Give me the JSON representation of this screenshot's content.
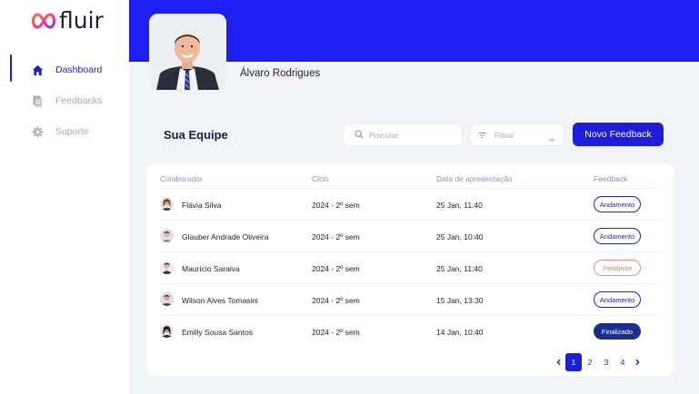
{
  "brand": {
    "name": "fluir",
    "accent": "#1E1ED8",
    "header_color": "#1E1EF0",
    "dark": "#1B2E8C",
    "pending": "#F07070"
  },
  "sidebar": {
    "items": [
      {
        "label": "Dashboard",
        "icon": "home-icon",
        "active": true
      },
      {
        "label": "Feedbacks",
        "icon": "document-icon",
        "active": false
      },
      {
        "label": "Suporte",
        "icon": "gear-icon",
        "active": false
      }
    ]
  },
  "profile": {
    "name": "Álvaro Rodrigues"
  },
  "team": {
    "title": "Sua Equipe",
    "search_placeholder": "Procurar",
    "filter_label": "Filtrar",
    "new_button": "Novo Feedback",
    "columns": [
      "Colaborador",
      "Ciclo",
      "Data de apresentação",
      "Feedback"
    ],
    "rows": [
      {
        "name": "Flávia Silva",
        "cycle": "2024 - 2º sem",
        "date": "25 Jan, 11:40",
        "status": "Andamento",
        "status_type": "andamento"
      },
      {
        "name": "Glauber Andrade Oliveira",
        "cycle": "2024 - 2º sem",
        "date": "25 Jan, 10:40",
        "status": "Andamento",
        "status_type": "andamento"
      },
      {
        "name": "Maurício Saraiva",
        "cycle": "2024 - 2º sem",
        "date": "25 Jan, 11:40",
        "status": "Pendente",
        "status_type": "pendente"
      },
      {
        "name": "Wilson Alves Tomasini",
        "cycle": "2024 - 2º sem",
        "date": "15 Jan, 13:30",
        "status": "Andamento",
        "status_type": "andamento"
      },
      {
        "name": "Emilly Sousa Santos",
        "cycle": "2024 - 2º sem",
        "date": "14 Jan, 10:40",
        "status": "Finalizado",
        "status_type": "finalizado"
      }
    ]
  },
  "pagination": {
    "pages": [
      "1",
      "2",
      "3",
      "4"
    ],
    "current": "1"
  }
}
